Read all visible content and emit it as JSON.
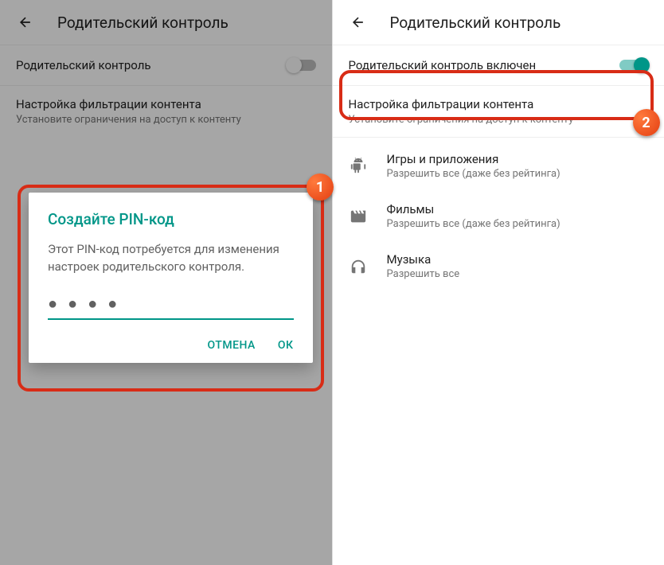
{
  "left": {
    "header_title": "Родительский контроль",
    "toggle_label": "Родительский контроль",
    "filter_title": "Настройка фильтрации контента",
    "filter_sub": "Установите ограничения на доступ к контенту",
    "dialog": {
      "title": "Создайте PIN-код",
      "body": "Этот PIN-код потребуется для изменения настроек родительского контроля.",
      "pin": "● ● ● ●",
      "cancel": "ОТМЕНА",
      "ok": "ОК"
    }
  },
  "right": {
    "header_title": "Родительский контроль",
    "toggle_label": "Родительский контроль включен",
    "filter_title": "Настройка фильтрации контента",
    "filter_sub": "Установите ограничения на доступ к контенту",
    "items": [
      {
        "title": "Игры и приложения",
        "sub": "Разрешить все (даже без рейтинга)"
      },
      {
        "title": "Фильмы",
        "sub": "Разрешить все (даже без рейтинга)"
      },
      {
        "title": "Музыка",
        "sub": "Разрешить все"
      }
    ]
  },
  "markers": {
    "one": "1",
    "two": "2"
  }
}
